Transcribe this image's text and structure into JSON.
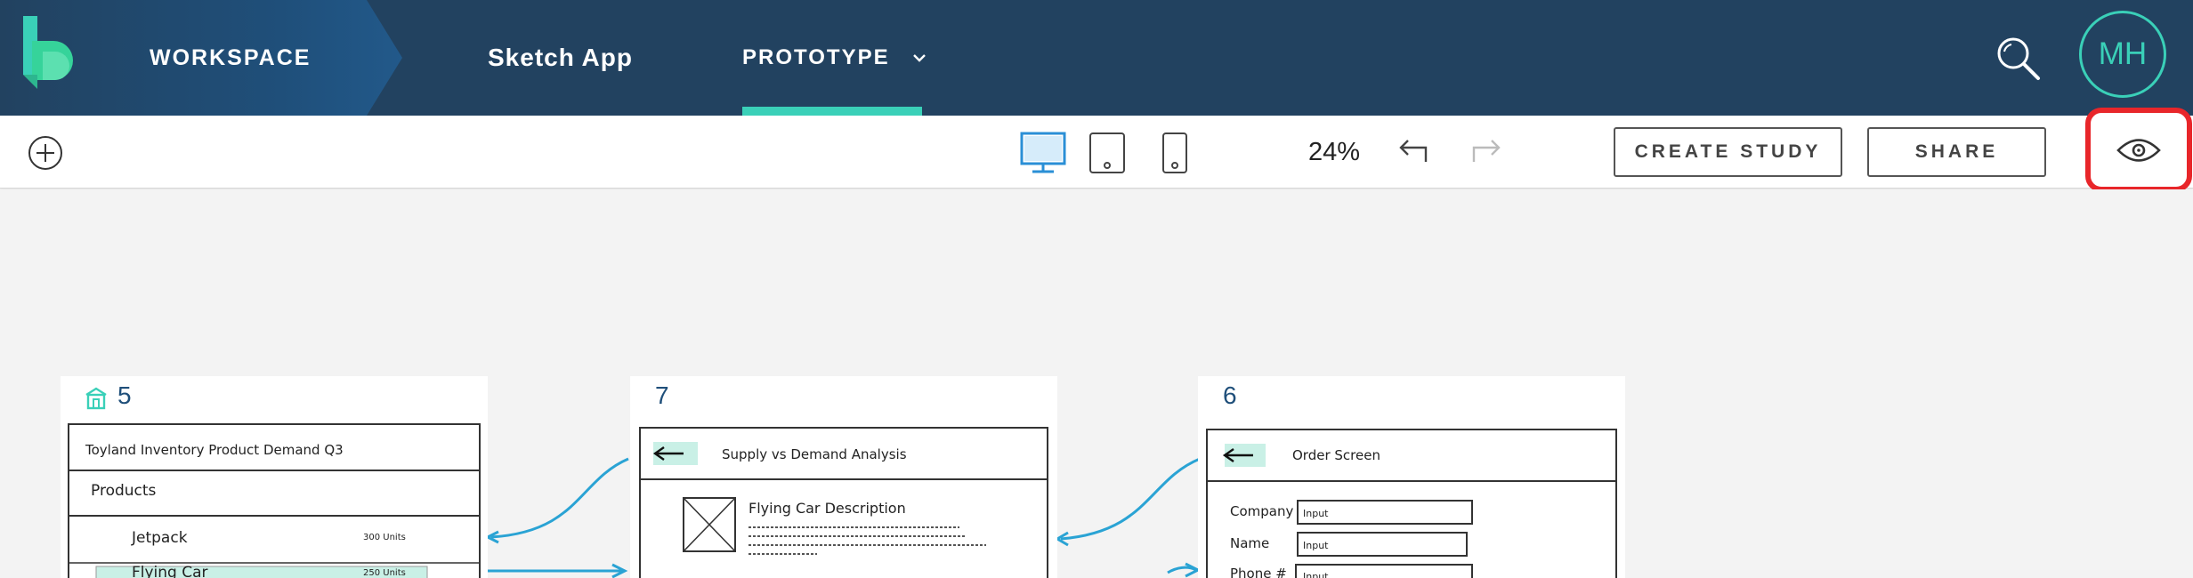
{
  "header": {
    "workspace_label": "WORKSPACE",
    "project_label": "Sketch App",
    "prototype_label": "PROTOTYPE",
    "avatar_initials": "MH"
  },
  "toolbar": {
    "zoom": "24%",
    "create_study_label": "CREATE STUDY",
    "share_label": "SHARE",
    "active_device": "desktop"
  },
  "colors": {
    "header_bg": "#224260",
    "accent": "#3ad0b8",
    "device_active": "#2a8fd6",
    "highlight_box": "#e8262a",
    "link_arrow": "#2aa3d4",
    "sketch_fill": "#c9f0e6"
  },
  "screens": [
    {
      "number": "5",
      "is_home": true,
      "title": "Toyland Inventory Product Demand Q3",
      "section": "Products",
      "rows": [
        {
          "name": "Jetpack",
          "units": "300 Units"
        },
        {
          "name": "Flying Car",
          "units": "250 Units"
        }
      ]
    },
    {
      "number": "7",
      "is_home": false,
      "title": "Supply vs Demand Analysis",
      "item_title": "Flying Car Description"
    },
    {
      "number": "6",
      "is_home": false,
      "title": "Order Screen",
      "fields": [
        {
          "label": "Company",
          "value": "Input"
        },
        {
          "label": "Name",
          "value": "Input"
        },
        {
          "label": "Phone #",
          "value": "Input"
        }
      ]
    }
  ]
}
